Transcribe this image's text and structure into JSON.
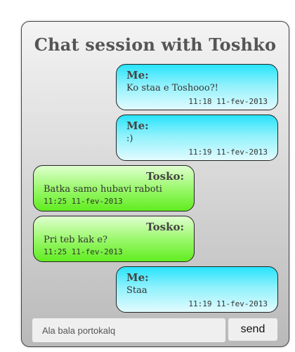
{
  "chat": {
    "title": "Chat session with Toshko",
    "messages": [
      {
        "role": "me",
        "sender": "Me:",
        "text": "Ko staa e Toshooo?!",
        "time": "11:18 11-fev-2013"
      },
      {
        "role": "me",
        "sender": "Me:",
        "text": ":)",
        "time": "11:19 11-fev-2013"
      },
      {
        "role": "other",
        "sender": "Tosko:",
        "text": "Batka samo hubavi raboti",
        "time": "11:25 11-fev-2013"
      },
      {
        "role": "other",
        "sender": "Tosko:",
        "text": "Pri teb kak e?",
        "time": "11:25 11-fev-2013"
      },
      {
        "role": "me",
        "sender": "Me:",
        "text": "Staa",
        "time": "11:19 11-fev-2013"
      }
    ],
    "input": {
      "value": "Ala bala portokalq"
    },
    "send_label": "send"
  },
  "colors": {
    "me_bubble_top": "#27e3fb",
    "me_bubble_bottom": "#e2fbff",
    "other_bubble_top": "#dfffcf",
    "other_bubble_bottom": "#61ec20",
    "title": "#555555"
  }
}
